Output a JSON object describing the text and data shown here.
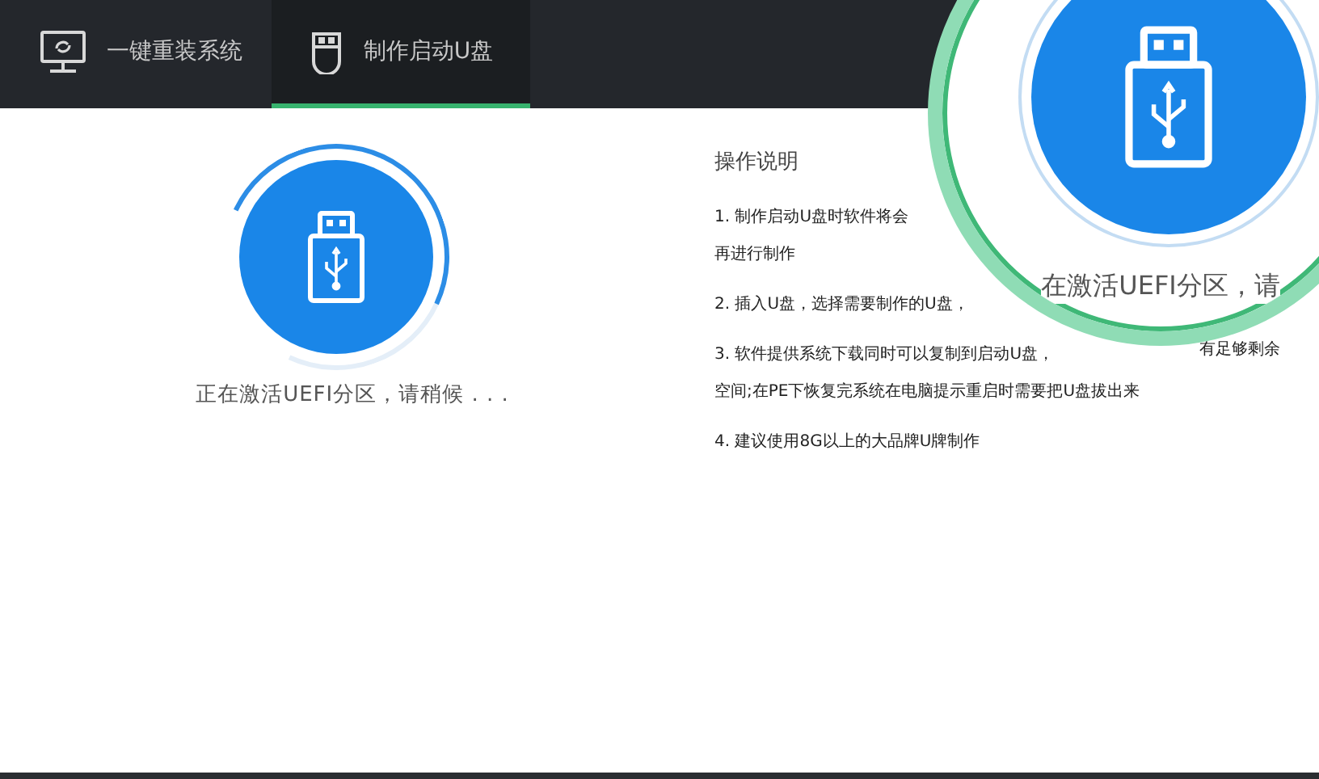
{
  "tabs": [
    {
      "kind": "system",
      "label": "一键重装系统",
      "selected": false
    },
    {
      "kind": "usb",
      "label": "制作启动U盘",
      "selected": true
    }
  ],
  "progress": {
    "status": "正在激活UEFI分区，请稍候 . . ."
  },
  "instructions": {
    "title": "操作说明",
    "items": [
      {
        "lines": [
          "1.  制作启动U盘时软件将会",
          "再进行制作"
        ]
      },
      {
        "lines": [
          "2.  插入U盘，选择需要制作的U盘，"
        ]
      },
      {
        "lines": [
          "3.   软件提供系统下载同时可以复制到启动U盘，",
          "有足够剩余",
          "空间;在PE下恢复完系统在电脑提示重启时需要把U盘拔出来"
        ]
      },
      {
        "lines": [
          "4.  建议使用8G以上的大品牌U牌制作"
        ]
      }
    ]
  },
  "magnifier": {
    "status": "在激活UEFI分区，请"
  }
}
